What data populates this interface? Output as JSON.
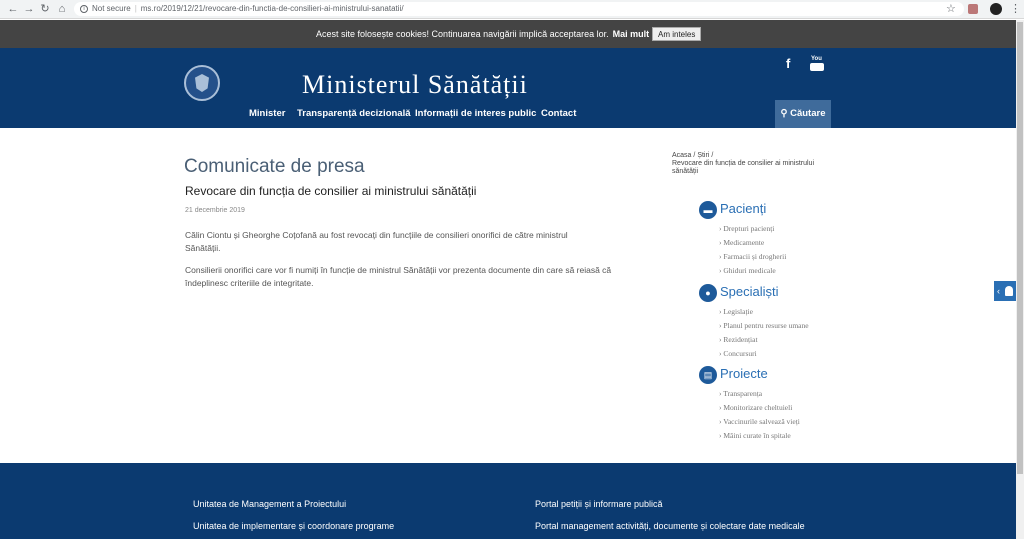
{
  "browser": {
    "not_secure": "Not secure",
    "url": "ms.ro/2019/12/21/revocare-din-functia-de-consilieri-ai-ministrului-sanatatii/"
  },
  "cookie": {
    "message": "Acest site folosește cookies! Continuarea navigării implică acceptarea lor.",
    "more_label": "Mai mult",
    "accept_label": "Am inteles"
  },
  "header": {
    "site_title": "Ministerul Sănătății",
    "nav": [
      "Minister",
      "Transparență decizională",
      "Informații de interes public",
      "Contact"
    ],
    "search_label": "Căutare",
    "facebook": "f",
    "youtube": "You"
  },
  "main": {
    "page_heading": "Comunicate de presa",
    "article_title": "Revocare din funcția de consilier ai ministrului sănătății",
    "date": "21 decembrie 2019",
    "paragraphs": [
      "Călin Ciontu și Gheorghe Coțofană au fost revocați din funcțiile de consilieri onorifici de către ministrul Sănătății.",
      "Consilierii onorifici care vor fi numiți în funcție de ministrul Sănătății vor prezenta documente din care să reiasă că îndeplinesc criteriile de integritate."
    ]
  },
  "breadcrumb": {
    "home": "Acasa",
    "news": "Știri",
    "current": "Revocare din funcția de consilier ai ministrului sănătății"
  },
  "sidebar": {
    "sections": [
      {
        "title": "Pacienți",
        "icon": "bed-icon",
        "items": [
          "Drepturi pacienți",
          "Medicamente",
          "Farmacii și drogherii",
          "Ghiduri medicale"
        ]
      },
      {
        "title": "Specialiști",
        "icon": "doctor-icon",
        "items": [
          "Legislație",
          "Planul pentru resurse umane",
          "Rezidențiat",
          "Concursuri"
        ]
      },
      {
        "title": "Proiecte",
        "icon": "document-icon",
        "items": [
          "Transparența",
          "Monitorizare cheltuieli",
          "Vaccinurile salvează vieți",
          "Mâini curate în spitale"
        ]
      }
    ]
  },
  "footer": {
    "links": [
      "Unitatea de Management a Proiectului",
      "Unitatea de implementare și coordonare programe",
      "Portal petiții și informare publică",
      "Portal management activități, documente și colectare date medicale"
    ]
  },
  "colors": {
    "header_bg": "#0b3a70",
    "cookie_bg": "#444444",
    "accent": "#2a6fb4"
  }
}
